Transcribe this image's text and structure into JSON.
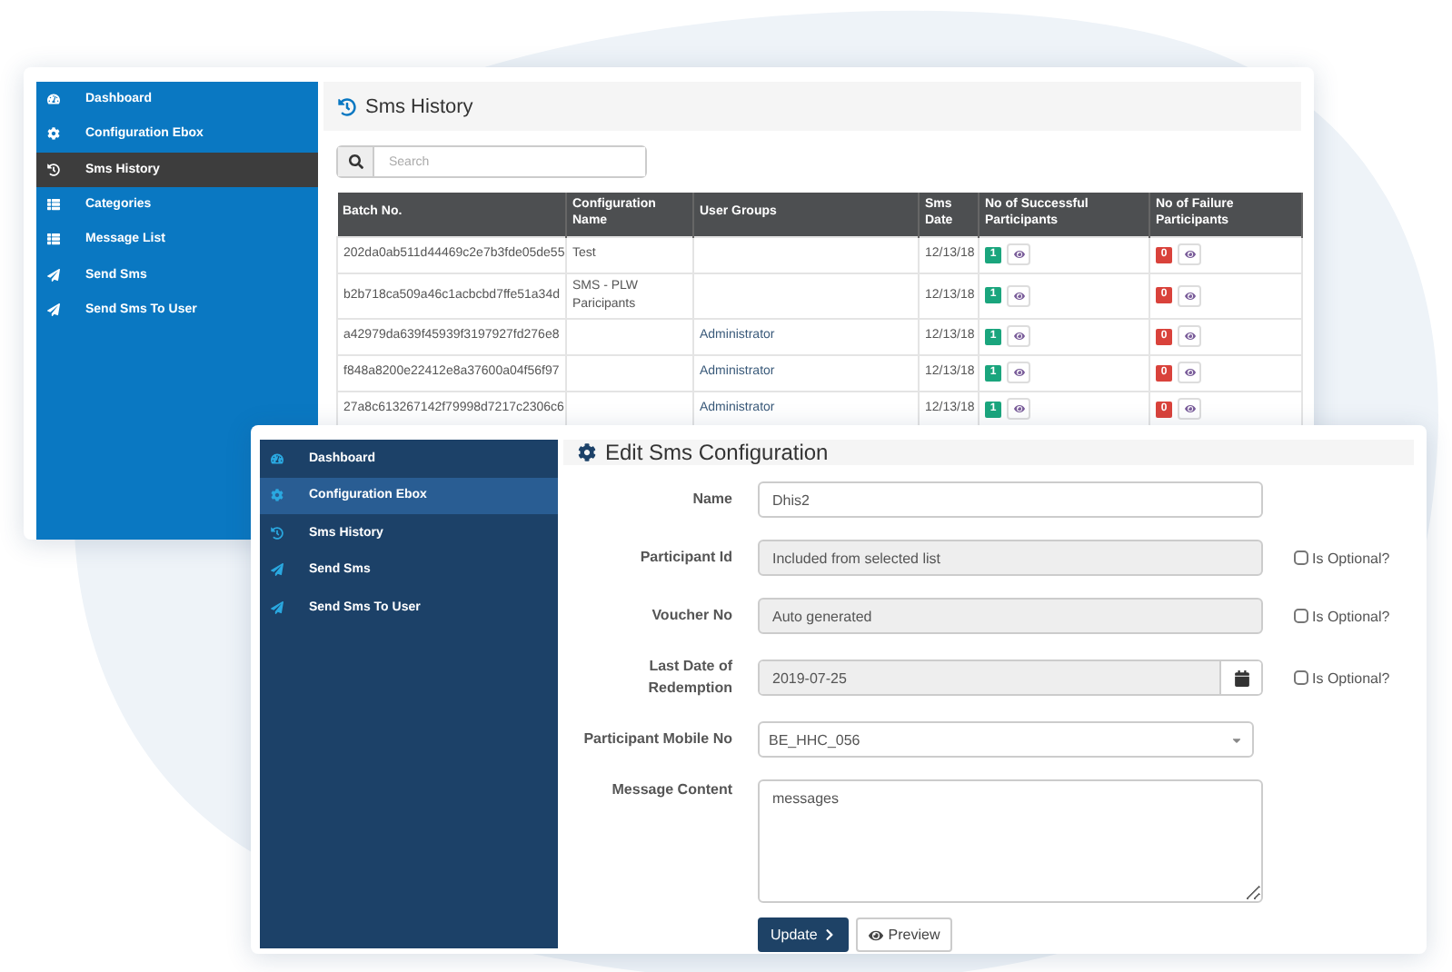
{
  "history_window": {
    "sidebar": {
      "items": [
        {
          "label": "Dashboard",
          "kind": "dashboard",
          "selected": false
        },
        {
          "label": "Configuration Ebox",
          "kind": "settings",
          "selected": false
        },
        {
          "label": "Sms History",
          "kind": "history",
          "selected": true
        },
        {
          "label": "Categories",
          "kind": "list",
          "selected": false
        },
        {
          "label": "Message List",
          "kind": "list",
          "selected": false
        },
        {
          "label": "Send Sms",
          "kind": "send",
          "selected": false
        },
        {
          "label": "Send Sms To User",
          "kind": "send",
          "selected": false
        }
      ]
    },
    "title": "Sms History",
    "search": {
      "placeholder": "Search"
    },
    "table": {
      "columns": [
        "Batch No.",
        "Configuration Name",
        "User Groups",
        "Sms Date",
        "No of Successful Participants",
        "No of Failure Participants"
      ],
      "rows": [
        {
          "batch": "202da0ab511d44469c2e7b3fde05de55",
          "configuration": "Test",
          "user_groups": "",
          "date": "12/13/18",
          "successful": "1",
          "failure": "0"
        },
        {
          "batch": "b2b718ca509a46c1acbcbd7ffe51a34d",
          "configuration": "SMS - PLW Paricipants",
          "user_groups": "",
          "date": "12/13/18",
          "successful": "1",
          "failure": "0"
        },
        {
          "batch": "a42979da639f45939f3197927fd276e8",
          "configuration": "",
          "user_groups": "Administrator",
          "date": "12/13/18",
          "successful": "1",
          "failure": "0"
        },
        {
          "batch": "f848a8200e22412e8a37600a04f56f97",
          "configuration": "",
          "user_groups": "Administrator",
          "date": "12/13/18",
          "successful": "1",
          "failure": "0"
        },
        {
          "batch": "27a8c613267142f79998d7217c2306c6",
          "configuration": "",
          "user_groups": "Administrator",
          "date": "12/13/18",
          "successful": "1",
          "failure": "0"
        }
      ]
    }
  },
  "config_window": {
    "sidebar": {
      "items": [
        {
          "label": "Dashboard",
          "kind": "dashboard",
          "selected": false
        },
        {
          "label": "Configuration Ebox",
          "kind": "settings",
          "selected": true
        },
        {
          "label": "Sms History",
          "kind": "history",
          "selected": false
        },
        {
          "label": "Send Sms",
          "kind": "send",
          "selected": false
        },
        {
          "label": "Send Sms To User",
          "kind": "send",
          "selected": false
        }
      ]
    },
    "title": "Edit Sms Configuration",
    "fields": [
      {
        "label": "Name",
        "kind": "text",
        "value": "Dhis2"
      },
      {
        "label": "Participant Id",
        "kind": "readonly",
        "value": "Included from selected list",
        "optional": {
          "label": "Is Optional?",
          "checked": false
        }
      },
      {
        "label": "Voucher No",
        "kind": "readonly",
        "value": "Auto generated",
        "optional": {
          "label": "Is Optional?",
          "checked": false
        }
      },
      {
        "label": "Last Date of Redemption",
        "kind": "date",
        "value": "2019-07-25",
        "optional": {
          "label": "Is Optional?",
          "checked": false
        }
      },
      {
        "label": "Participant Mobile No",
        "kind": "select",
        "value": "BE_HHC_056"
      },
      {
        "label": "Message Content",
        "kind": "textarea",
        "value": "messages"
      }
    ],
    "buttons": [
      {
        "label": "Update",
        "kind": "primary"
      },
      {
        "label": "Preview",
        "kind": "preview"
      }
    ]
  }
}
